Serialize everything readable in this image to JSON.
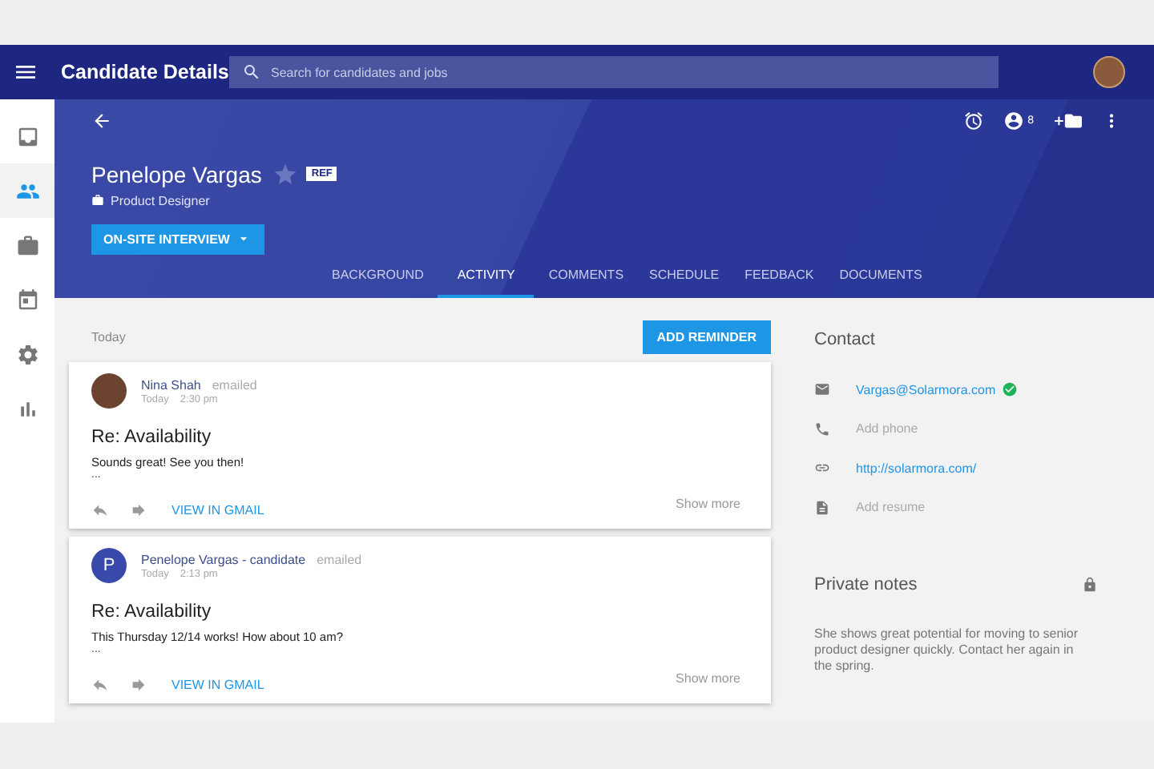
{
  "top_bar": {
    "title": "Candidate Details",
    "search": {
      "placeholder": "Search for candidates and jobs"
    }
  },
  "sidebar": {
    "items": [
      {
        "kind": "inbox",
        "selected": false
      },
      {
        "kind": "people",
        "selected": true
      },
      {
        "kind": "briefcase",
        "selected": false
      },
      {
        "kind": "calendar",
        "selected": false
      },
      {
        "kind": "settings",
        "selected": false
      },
      {
        "kind": "chart",
        "selected": false
      }
    ]
  },
  "header": {
    "candidate_name": "Penelope Vargas",
    "starred": false,
    "badge": "REF",
    "role": "Product Designer",
    "stage_button": "ON-SITE INTERVIEW",
    "people_count": "8",
    "tabs": [
      {
        "label": "BACKGROUND",
        "selected": false
      },
      {
        "label": "ACTIVITY",
        "selected": true
      },
      {
        "label": "COMMENTS",
        "selected": false
      },
      {
        "label": "SCHEDULE",
        "selected": false
      },
      {
        "label": "FEEDBACK",
        "selected": false
      },
      {
        "label": "DOCUMENTS",
        "selected": false
      }
    ]
  },
  "activity": {
    "date_label": "Today",
    "add_button": "ADD REMINDER",
    "entries": [
      {
        "sender": "Nina Shah",
        "action": "emailed",
        "date": "Today",
        "time": "2:30 pm",
        "avatar": {
          "kind": "photo"
        },
        "subject": "Re: Availability",
        "body": "Sounds great! See you then!",
        "ellipsis": "...",
        "link": "VIEW IN GMAIL",
        "more": "Show more"
      },
      {
        "sender": "Penelope Vargas - candidate",
        "action": "emailed",
        "date": "Today",
        "time": "2:13 pm",
        "avatar": {
          "kind": "initial",
          "letter": "P"
        },
        "subject": "Re: Availability",
        "body": "This Thursday 12/14 works! How about 10 am?",
        "ellipsis": "...",
        "link": "VIEW IN GMAIL",
        "more": "Show more"
      }
    ]
  },
  "contact": {
    "title": "Contact",
    "items": [
      {
        "kind": "email",
        "text": "Vargas@Solarmora.com",
        "filled": true,
        "verified": true
      },
      {
        "kind": "phone",
        "text": "Add phone",
        "filled": false,
        "verified": false
      },
      {
        "kind": "link",
        "text": "http://solarmora.com/",
        "filled": true,
        "verified": false
      },
      {
        "kind": "resume",
        "text": "Add resume",
        "filled": false,
        "verified": false
      }
    ]
  },
  "notes": {
    "title": "Private notes",
    "locked": true,
    "text": "She shows great potential for moving to senior product designer quickly. Contact her again in the spring."
  }
}
